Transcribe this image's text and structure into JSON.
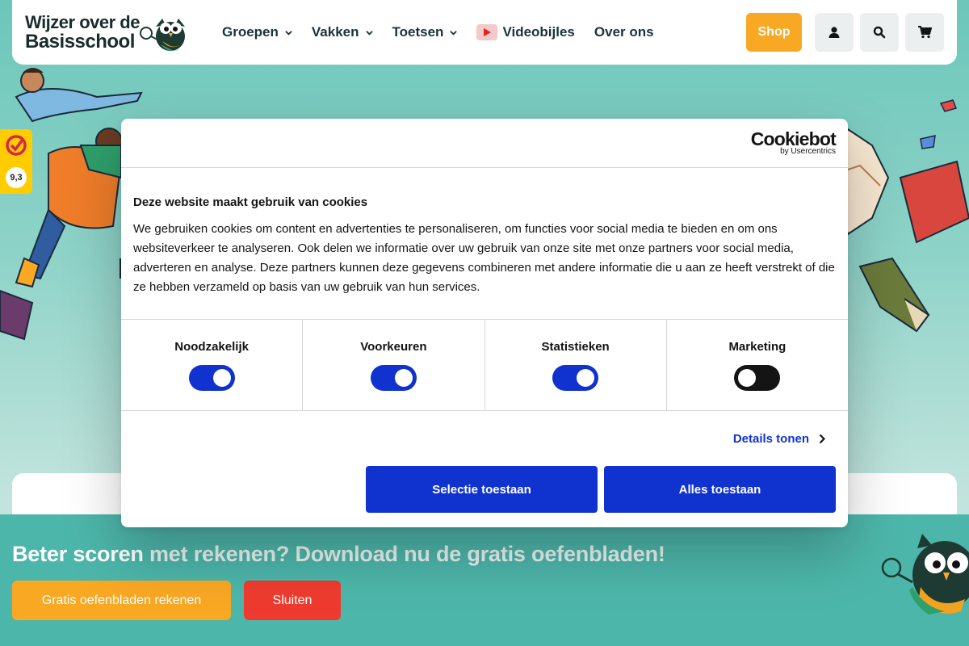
{
  "header": {
    "logo_line1": "Wijzer over de",
    "logo_line2": "Basisschool",
    "nav": [
      {
        "label": "Groepen",
        "dropdown": true
      },
      {
        "label": "Vakken",
        "dropdown": true
      },
      {
        "label": "Toetsen",
        "dropdown": true
      },
      {
        "label": "Videobijles",
        "icon": "youtube-play-icon"
      },
      {
        "label": "Over ons"
      }
    ],
    "shop_label": "Shop",
    "icons": [
      "user-icon",
      "search-icon",
      "cart-icon"
    ]
  },
  "rating": {
    "score": "9,3"
  },
  "cookie": {
    "brand": "Cookiebot",
    "brand_sub": "by Usercentrics",
    "heading": "Deze website maakt gebruik van cookies",
    "text": "We gebruiken cookies om content en advertenties te personaliseren, om functies voor social media te bieden en om ons websiteverkeer te analyseren. Ook delen we informatie over uw gebruik van onze site met onze partners voor social media, adverteren en analyse. Deze partners kunnen deze gegevens combineren met andere informatie die u aan ze heeft verstrekt of die ze hebben verzameld op basis van uw gebruik van hun services.",
    "categories": [
      {
        "label": "Noodzakelijk",
        "enabled": true
      },
      {
        "label": "Voorkeuren",
        "enabled": true
      },
      {
        "label": "Statistieken",
        "enabled": true
      },
      {
        "label": "Marketing",
        "enabled": false
      }
    ],
    "details_label": "Details tonen",
    "button_selection": "Selectie toestaan",
    "button_all": "Alles toestaan"
  },
  "promo": {
    "title_start": "Beter scoren",
    "title_rest": " met rekenen? Download nu de gratis oefenbladen!",
    "primary_button": "Gratis oefenbladen rekenen",
    "secondary_button": "Sluiten"
  },
  "colors": {
    "brand_orange": "#f9a823",
    "cookie_blue": "#1032cf",
    "teal": "#4db6aa",
    "close_red": "#ef3b2f"
  }
}
